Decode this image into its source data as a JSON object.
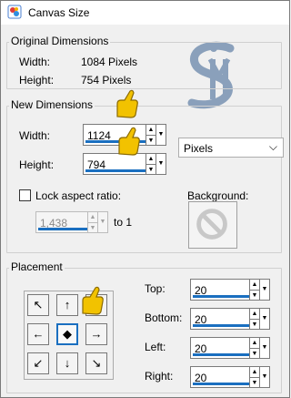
{
  "window": {
    "title": "Canvas Size"
  },
  "original": {
    "legend": "Original Dimensions",
    "width_label": "Width:",
    "width_value": "1084 Pixels",
    "height_label": "Height:",
    "height_value": "754 Pixels"
  },
  "new_dims": {
    "legend": "New Dimensions",
    "width_label": "Width:",
    "width_value": "1124",
    "height_label": "Height:",
    "height_value": "794",
    "units": "Pixels",
    "lock_label": "Lock aspect ratio:",
    "lock_checked": false,
    "ratio_value": "1,438",
    "ratio_suffix": "to 1",
    "background_label": "Background:"
  },
  "placement": {
    "legend": "Placement",
    "top_label": "Top:",
    "top_value": "20",
    "bottom_label": "Bottom:",
    "bottom_value": "20",
    "left_label": "Left:",
    "left_value": "20",
    "right_label": "Right:",
    "right_value": "20",
    "selected_anchor": "center"
  },
  "colors": {
    "accent": "#1a6fc0",
    "pointer_hand": "#f2c200"
  },
  "icons": [
    "app-icon",
    "pointer-hand-icon",
    "no-symbol-icon",
    "arrow-up-icon",
    "arrow-down-icon",
    "chevron-down-icon"
  ]
}
